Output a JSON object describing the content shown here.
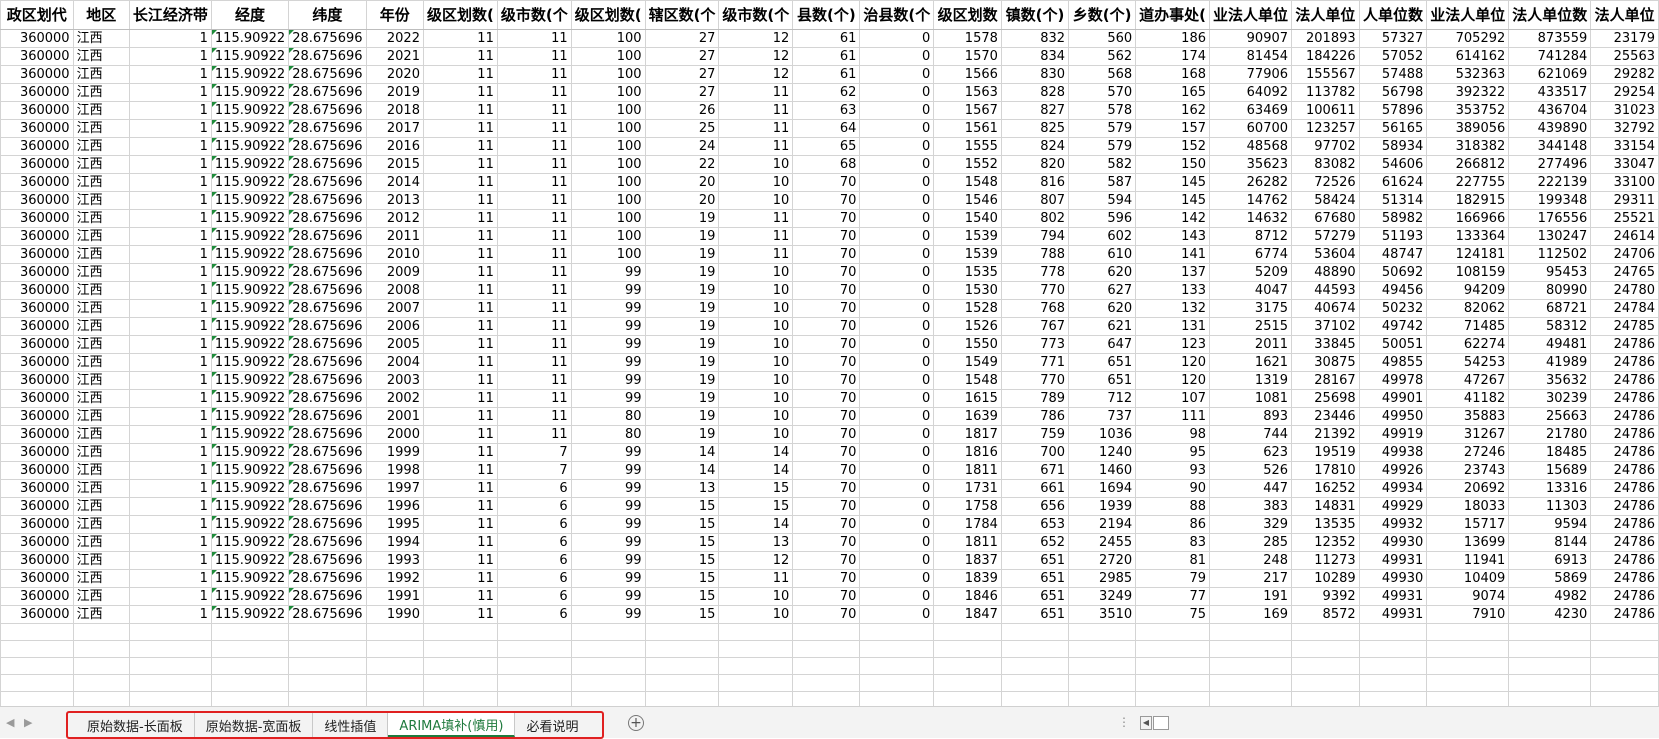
{
  "headers": [
    "政区划代",
    "地区",
    "长江经济带",
    "经度",
    "纬度",
    "年份",
    "级区划数(",
    "级市数(个",
    "级区划数(",
    "辖区数(个",
    "级市数(个",
    "县数(个)",
    "治县数(个",
    "级区划数",
    "镇数(个)",
    "乡数(个)",
    "道办事处(",
    "业法人单位",
    "法人单位",
    "人单位数",
    "业法人单位",
    "法人单位数",
    "法人单位"
  ],
  "rows": [
    [
      "360000",
      "江西",
      "1",
      "115.90922",
      "28.675696",
      "2022",
      "11",
      "11",
      "100",
      "27",
      "12",
      "61",
      "0",
      "1578",
      "832",
      "560",
      "186",
      "90907",
      "201893",
      "57327",
      "705292",
      "873559",
      "23179"
    ],
    [
      "360000",
      "江西",
      "1",
      "115.90922",
      "28.675696",
      "2021",
      "11",
      "11",
      "100",
      "27",
      "12",
      "61",
      "0",
      "1570",
      "834",
      "562",
      "174",
      "81454",
      "184226",
      "57052",
      "614162",
      "741284",
      "25563"
    ],
    [
      "360000",
      "江西",
      "1",
      "115.90922",
      "28.675696",
      "2020",
      "11",
      "11",
      "100",
      "27",
      "12",
      "61",
      "0",
      "1566",
      "830",
      "568",
      "168",
      "77906",
      "155567",
      "57488",
      "532363",
      "621069",
      "29282"
    ],
    [
      "360000",
      "江西",
      "1",
      "115.90922",
      "28.675696",
      "2019",
      "11",
      "11",
      "100",
      "27",
      "11",
      "62",
      "0",
      "1563",
      "828",
      "570",
      "165",
      "64092",
      "113782",
      "56798",
      "392322",
      "433517",
      "29254"
    ],
    [
      "360000",
      "江西",
      "1",
      "115.90922",
      "28.675696",
      "2018",
      "11",
      "11",
      "100",
      "26",
      "11",
      "63",
      "0",
      "1567",
      "827",
      "578",
      "162",
      "63469",
      "100611",
      "57896",
      "353752",
      "436704",
      "31023"
    ],
    [
      "360000",
      "江西",
      "1",
      "115.90922",
      "28.675696",
      "2017",
      "11",
      "11",
      "100",
      "25",
      "11",
      "64",
      "0",
      "1561",
      "825",
      "579",
      "157",
      "60700",
      "123257",
      "56165",
      "389056",
      "439890",
      "32792"
    ],
    [
      "360000",
      "江西",
      "1",
      "115.90922",
      "28.675696",
      "2016",
      "11",
      "11",
      "100",
      "24",
      "11",
      "65",
      "0",
      "1555",
      "824",
      "579",
      "152",
      "48568",
      "97702",
      "58934",
      "318382",
      "344148",
      "33154"
    ],
    [
      "360000",
      "江西",
      "1",
      "115.90922",
      "28.675696",
      "2015",
      "11",
      "11",
      "100",
      "22",
      "10",
      "68",
      "0",
      "1552",
      "820",
      "582",
      "150",
      "35623",
      "83082",
      "54606",
      "266812",
      "277496",
      "33047"
    ],
    [
      "360000",
      "江西",
      "1",
      "115.90922",
      "28.675696",
      "2014",
      "11",
      "11",
      "100",
      "20",
      "10",
      "70",
      "0",
      "1548",
      "816",
      "587",
      "145",
      "26282",
      "72526",
      "61624",
      "227755",
      "222139",
      "33100"
    ],
    [
      "360000",
      "江西",
      "1",
      "115.90922",
      "28.675696",
      "2013",
      "11",
      "11",
      "100",
      "20",
      "10",
      "70",
      "0",
      "1546",
      "807",
      "594",
      "145",
      "14762",
      "58424",
      "51314",
      "182915",
      "199348",
      "29311"
    ],
    [
      "360000",
      "江西",
      "1",
      "115.90922",
      "28.675696",
      "2012",
      "11",
      "11",
      "100",
      "19",
      "11",
      "70",
      "0",
      "1540",
      "802",
      "596",
      "142",
      "14632",
      "67680",
      "58982",
      "166966",
      "176556",
      "25521"
    ],
    [
      "360000",
      "江西",
      "1",
      "115.90922",
      "28.675696",
      "2011",
      "11",
      "11",
      "100",
      "19",
      "11",
      "70",
      "0",
      "1539",
      "794",
      "602",
      "143",
      "8712",
      "57279",
      "51193",
      "133364",
      "130247",
      "24614"
    ],
    [
      "360000",
      "江西",
      "1",
      "115.90922",
      "28.675696",
      "2010",
      "11",
      "11",
      "100",
      "19",
      "11",
      "70",
      "0",
      "1539",
      "788",
      "610",
      "141",
      "6774",
      "53604",
      "48747",
      "124181",
      "112502",
      "24706"
    ],
    [
      "360000",
      "江西",
      "1",
      "115.90922",
      "28.675696",
      "2009",
      "11",
      "11",
      "99",
      "19",
      "10",
      "70",
      "0",
      "1535",
      "778",
      "620",
      "137",
      "5209",
      "48890",
      "50692",
      "108159",
      "95453",
      "24765"
    ],
    [
      "360000",
      "江西",
      "1",
      "115.90922",
      "28.675696",
      "2008",
      "11",
      "11",
      "99",
      "19",
      "10",
      "70",
      "0",
      "1530",
      "770",
      "627",
      "133",
      "4047",
      "44593",
      "49456",
      "94209",
      "80990",
      "24780"
    ],
    [
      "360000",
      "江西",
      "1",
      "115.90922",
      "28.675696",
      "2007",
      "11",
      "11",
      "99",
      "19",
      "10",
      "70",
      "0",
      "1528",
      "768",
      "620",
      "132",
      "3175",
      "40674",
      "50232",
      "82062",
      "68721",
      "24784"
    ],
    [
      "360000",
      "江西",
      "1",
      "115.90922",
      "28.675696",
      "2006",
      "11",
      "11",
      "99",
      "19",
      "10",
      "70",
      "0",
      "1526",
      "767",
      "621",
      "131",
      "2515",
      "37102",
      "49742",
      "71485",
      "58312",
      "24785"
    ],
    [
      "360000",
      "江西",
      "1",
      "115.90922",
      "28.675696",
      "2005",
      "11",
      "11",
      "99",
      "19",
      "10",
      "70",
      "0",
      "1550",
      "773",
      "647",
      "123",
      "2011",
      "33845",
      "50051",
      "62274",
      "49481",
      "24786"
    ],
    [
      "360000",
      "江西",
      "1",
      "115.90922",
      "28.675696",
      "2004",
      "11",
      "11",
      "99",
      "19",
      "10",
      "70",
      "0",
      "1549",
      "771",
      "651",
      "120",
      "1621",
      "30875",
      "49855",
      "54253",
      "41989",
      "24786"
    ],
    [
      "360000",
      "江西",
      "1",
      "115.90922",
      "28.675696",
      "2003",
      "11",
      "11",
      "99",
      "19",
      "10",
      "70",
      "0",
      "1548",
      "770",
      "651",
      "120",
      "1319",
      "28167",
      "49978",
      "47267",
      "35632",
      "24786"
    ],
    [
      "360000",
      "江西",
      "1",
      "115.90922",
      "28.675696",
      "2002",
      "11",
      "11",
      "99",
      "19",
      "10",
      "70",
      "0",
      "1615",
      "789",
      "712",
      "107",
      "1081",
      "25698",
      "49901",
      "41182",
      "30239",
      "24786"
    ],
    [
      "360000",
      "江西",
      "1",
      "115.90922",
      "28.675696",
      "2001",
      "11",
      "11",
      "80",
      "19",
      "10",
      "70",
      "0",
      "1639",
      "786",
      "737",
      "111",
      "893",
      "23446",
      "49950",
      "35883",
      "25663",
      "24786"
    ],
    [
      "360000",
      "江西",
      "1",
      "115.90922",
      "28.675696",
      "2000",
      "11",
      "11",
      "80",
      "19",
      "10",
      "70",
      "0",
      "1817",
      "759",
      "1036",
      "98",
      "744",
      "21392",
      "49919",
      "31267",
      "21780",
      "24786"
    ],
    [
      "360000",
      "江西",
      "1",
      "115.90922",
      "28.675696",
      "1999",
      "11",
      "7",
      "99",
      "14",
      "14",
      "70",
      "0",
      "1816",
      "700",
      "1240",
      "95",
      "623",
      "19519",
      "49938",
      "27246",
      "18485",
      "24786"
    ],
    [
      "360000",
      "江西",
      "1",
      "115.90922",
      "28.675696",
      "1998",
      "11",
      "7",
      "99",
      "14",
      "14",
      "70",
      "0",
      "1811",
      "671",
      "1460",
      "93",
      "526",
      "17810",
      "49926",
      "23743",
      "15689",
      "24786"
    ],
    [
      "360000",
      "江西",
      "1",
      "115.90922",
      "28.675696",
      "1997",
      "11",
      "6",
      "99",
      "13",
      "15",
      "70",
      "0",
      "1731",
      "661",
      "1694",
      "90",
      "447",
      "16252",
      "49934",
      "20692",
      "13316",
      "24786"
    ],
    [
      "360000",
      "江西",
      "1",
      "115.90922",
      "28.675696",
      "1996",
      "11",
      "6",
      "99",
      "15",
      "15",
      "70",
      "0",
      "1758",
      "656",
      "1939",
      "88",
      "383",
      "14831",
      "49929",
      "18033",
      "11303",
      "24786"
    ],
    [
      "360000",
      "江西",
      "1",
      "115.90922",
      "28.675696",
      "1995",
      "11",
      "6",
      "99",
      "15",
      "14",
      "70",
      "0",
      "1784",
      "653",
      "2194",
      "86",
      "329",
      "13535",
      "49932",
      "15717",
      "9594",
      "24786"
    ],
    [
      "360000",
      "江西",
      "1",
      "115.90922",
      "28.675696",
      "1994",
      "11",
      "6",
      "99",
      "15",
      "13",
      "70",
      "0",
      "1811",
      "652",
      "2455",
      "83",
      "285",
      "12352",
      "49930",
      "13699",
      "8144",
      "24786"
    ],
    [
      "360000",
      "江西",
      "1",
      "115.90922",
      "28.675696",
      "1993",
      "11",
      "6",
      "99",
      "15",
      "12",
      "70",
      "0",
      "1837",
      "651",
      "2720",
      "81",
      "248",
      "11273",
      "49931",
      "11941",
      "6913",
      "24786"
    ],
    [
      "360000",
      "江西",
      "1",
      "115.90922",
      "28.675696",
      "1992",
      "11",
      "6",
      "99",
      "15",
      "11",
      "70",
      "0",
      "1839",
      "651",
      "2985",
      "79",
      "217",
      "10289",
      "49930",
      "10409",
      "5869",
      "24786"
    ],
    [
      "360000",
      "江西",
      "1",
      "115.90922",
      "28.675696",
      "1991",
      "11",
      "6",
      "99",
      "15",
      "10",
      "70",
      "0",
      "1846",
      "651",
      "3249",
      "77",
      "191",
      "9392",
      "49931",
      "9074",
      "4982",
      "24786"
    ],
    [
      "360000",
      "江西",
      "1",
      "115.90922",
      "28.675696",
      "1990",
      "11",
      "6",
      "99",
      "15",
      "10",
      "70",
      "0",
      "1847",
      "651",
      "3510",
      "75",
      "169",
      "8572",
      "49931",
      "7910",
      "4230",
      "24786"
    ]
  ],
  "blank_rows": 5,
  "sheet_tabs": [
    {
      "label": "原始数据-长面板",
      "active": false
    },
    {
      "label": "原始数据-宽面板",
      "active": false
    },
    {
      "label": "线性插值",
      "active": false
    },
    {
      "label": "ARIMA填补(慎用)",
      "active": true
    },
    {
      "label": "必看说明",
      "active": false
    }
  ],
  "icons": {
    "prev": "triangle-left-icon",
    "next": "triangle-right-icon",
    "add": "plus-circle-icon",
    "more": "ellipsis-icon",
    "scroll_left": "chevron-left-icon"
  },
  "colors": {
    "active_tab": "#1f7a3d",
    "highlight_frame": "#e02020",
    "error_flag": "#1e8c3a"
  }
}
